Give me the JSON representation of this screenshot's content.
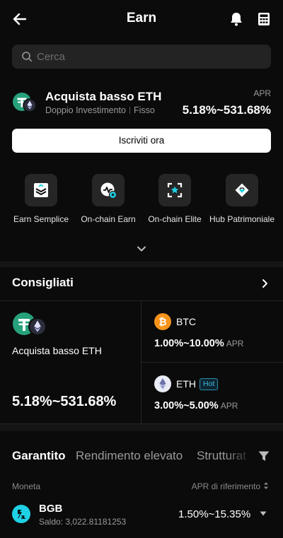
{
  "header": {
    "title": "Earn",
    "back_icon": "arrow-left-icon",
    "notification_icon": "bell-icon",
    "calculator_icon": "calculator-icon"
  },
  "search": {
    "placeholder": "Cerca",
    "icon": "search-icon"
  },
  "promo": {
    "title": "Acquista basso ETH",
    "product": "Doppio Investimento",
    "term": "Fisso",
    "apr_label": "APR",
    "apr": "5.18%~531.68%",
    "cta": "Iscriviti ora"
  },
  "shortcuts": [
    {
      "label": "Earn Semplice",
      "icon": "simple-earn-icon"
    },
    {
      "label": "On-chain Earn",
      "icon": "onchain-earn-icon"
    },
    {
      "label": "On-chain Elite",
      "icon": "onchain-elite-icon"
    },
    {
      "label": "Hub Patrimoniale",
      "icon": "wealth-hub-icon"
    }
  ],
  "recommended": {
    "title": "Consigliati",
    "featured": {
      "title": "Acquista basso ETH",
      "apr": "5.18%~531.68%"
    },
    "coins": [
      {
        "name": "BTC",
        "apr": "1.00%~10.00%",
        "unit": "APR",
        "badge": ""
      },
      {
        "name": "ETH",
        "apr": "3.00%~5.00%",
        "unit": "APR",
        "badge": "Hot"
      }
    ]
  },
  "tabs": {
    "items": [
      "Garantito",
      "Rendimento elevato",
      "Strutturat"
    ],
    "active": "Garantito"
  },
  "list": {
    "col_coin": "Moneta",
    "col_apr": "APR di riferimento",
    "rows": [
      {
        "coin": "BGB",
        "balance": "Saldo: 3,022.81181253",
        "apr": "1.50%~15.35%"
      }
    ]
  },
  "colors": {
    "background": "#0b0b0b",
    "tether": "#26a17b",
    "btc": "#f7931a",
    "hot": "#42b7e0",
    "bgb": "#1fd1e6"
  }
}
